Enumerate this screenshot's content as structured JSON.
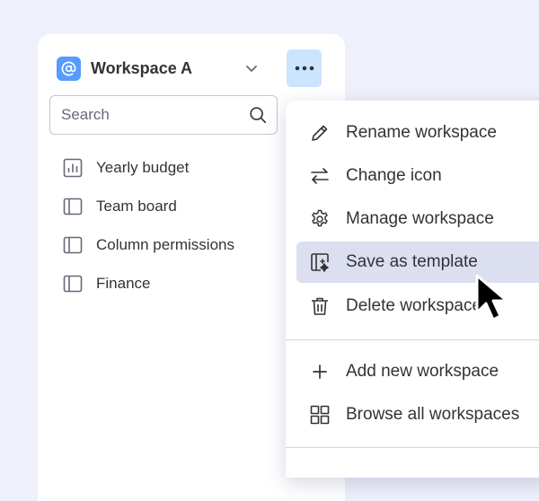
{
  "workspace": {
    "name": "Workspace A",
    "avatar_icon": "at-sign-icon",
    "avatar_color": "#579bfc",
    "more_button_bg": "#cce5ff"
  },
  "search": {
    "placeholder": "Search",
    "value": ""
  },
  "boards": [
    {
      "label": "Yearly budget",
      "icon": "dashboard-chart-icon"
    },
    {
      "label": "Team board",
      "icon": "board-icon"
    },
    {
      "label": "Column permissions",
      "icon": "board-icon"
    },
    {
      "label": "Finance",
      "icon": "board-icon"
    }
  ],
  "menu": {
    "items": [
      {
        "label": "Rename workspace",
        "icon": "pencil-icon"
      },
      {
        "label": "Change icon",
        "icon": "swap-arrows-icon"
      },
      {
        "label": "Manage workspace",
        "icon": "gear-icon"
      },
      {
        "label": "Save as template",
        "icon": "template-icon",
        "highlighted": true
      },
      {
        "label": "Delete workspace",
        "icon": "trash-icon"
      },
      {
        "label": "Add new workspace",
        "icon": "plus-icon"
      },
      {
        "label": "Browse all workspaces",
        "icon": "grid-icon"
      }
    ],
    "highlight_color": "#dcdff0"
  },
  "colors": {
    "background": "#eef0fb",
    "text": "#323338",
    "border": "#c3c6d4"
  }
}
